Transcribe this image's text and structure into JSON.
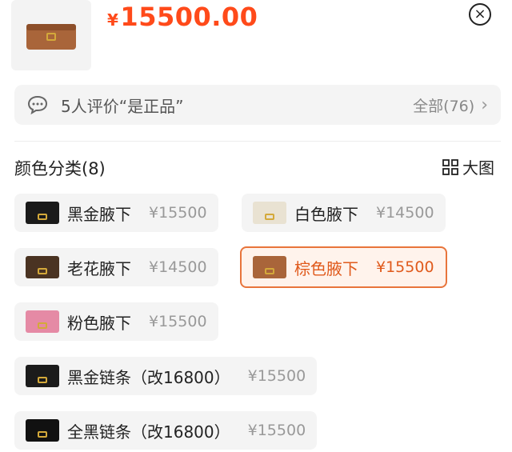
{
  "header": {
    "currency": "¥",
    "price": "15500.00",
    "close_symbol": "×"
  },
  "reviews": {
    "text": "5人评价“是正品”",
    "all_label": "全部(76)",
    "chevron": "›"
  },
  "section": {
    "title": "颜色分类(8)",
    "bigpic_label": "大图"
  },
  "variants": [
    {
      "label": "黑金腋下",
      "price": "¥15500",
      "color": "#1b1b1b",
      "selected": false
    },
    {
      "label": "白色腋下",
      "price": "¥14500",
      "color": "#e9e2d2",
      "selected": false
    },
    {
      "label": "老花腋下",
      "price": "¥14500",
      "color": "#4a3322",
      "selected": false
    },
    {
      "label": "棕色腋下",
      "price": "¥15500",
      "color": "#a9653a",
      "selected": true
    },
    {
      "label": "粉色腋下",
      "price": "¥15500",
      "color": "#e58aa5",
      "selected": false
    },
    {
      "label": "黑金链条（改16800）",
      "price": "¥15500",
      "color": "#1b1b1b",
      "selected": false
    },
    {
      "label": "全黑链条（改16800）",
      "price": "¥15500",
      "color": "#111111",
      "selected": false
    }
  ],
  "colors": {
    "accent": "#ff4a1a",
    "selected_border": "#e8743b"
  },
  "icons": {
    "review": "chat-bubble-icon",
    "grid": "grid-icon",
    "close": "close-icon"
  }
}
